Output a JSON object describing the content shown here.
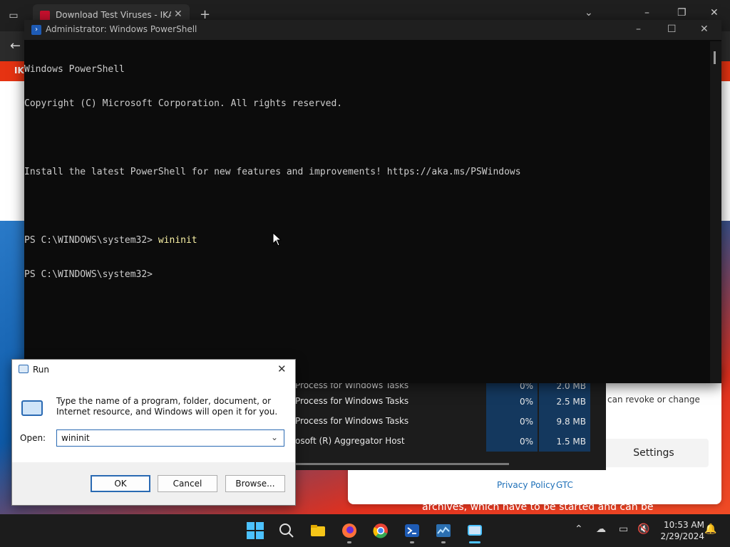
{
  "browser": {
    "tab_title": "Download Test Viruses - IKARUS",
    "tab_close": "✕",
    "new_tab": "+",
    "site_header_text": "IKARUS",
    "cookie_text": "can revoke or change",
    "settings_button": "Settings",
    "privacy_link": "Privacy Policy",
    "gtc_link": "GTC",
    "hero_text": "archives, which have to be started and can be"
  },
  "task_manager": {
    "rows": [
      {
        "name": "Process for Windows Tasks",
        "cpu": "0%",
        "memory": "2.0 MB"
      },
      {
        "name": "Process for Windows Tasks",
        "cpu": "0%",
        "memory": "2.5 MB"
      },
      {
        "name": "Process for Windows Tasks",
        "cpu": "0%",
        "memory": "9.8 MB"
      },
      {
        "name": "osoft (R) Aggregator Host",
        "cpu": "0%",
        "memory": "1.5 MB"
      }
    ]
  },
  "powershell": {
    "title": "Administrator: Windows PowerShell",
    "lines": {
      "l1": "Windows PowerShell",
      "l2": "Copyright (C) Microsoft Corporation. All rights reserved.",
      "l3": "",
      "l4": "Install the latest PowerShell for new features and improvements! https://aka.ms/PSWindows",
      "l5": "",
      "prompt1": "PS C:\\WINDOWS\\system32> ",
      "cmd1": "wininit",
      "prompt2": "PS C:\\WINDOWS\\system32>"
    }
  },
  "run_dialog": {
    "title": "Run",
    "description": "Type the name of a program, folder, document, or Internet resource, and Windows will open it for you.",
    "open_label": "Open:",
    "open_value": "wininit",
    "ok": "OK",
    "cancel": "Cancel",
    "browse": "Browse..."
  },
  "taskbar": {
    "time": "10:53 AM",
    "date": "2/29/2024"
  },
  "colors": {
    "accent": "#4cc2ff",
    "ikarus_red": "#e63312",
    "console_bg": "#0c0c0c"
  }
}
